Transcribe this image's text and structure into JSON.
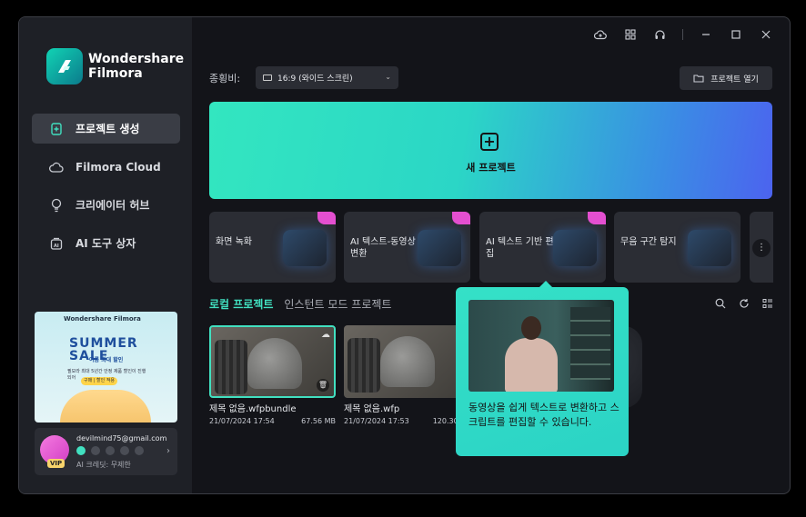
{
  "app": {
    "brand": "Wondershare",
    "product": "Filmora"
  },
  "sidebar": {
    "items": [
      {
        "label": "프로젝트 생성",
        "active": true
      },
      {
        "label": "Filmora Cloud",
        "active": false
      },
      {
        "label": "크리에이터 허브",
        "active": false
      },
      {
        "label": "AI 도구 상자",
        "active": false
      }
    ],
    "promo": {
      "brand": "Wondershare Filmora",
      "headline": "SUMMER SALE",
      "tagline": "여름 최대 할인",
      "detail": "필모라 최대 5년간 안정 제품 할인이 진행되어",
      "cta": "구매 | 할인 적용"
    },
    "account": {
      "email": "devilmind75@gmail.com",
      "vip": "VIP",
      "credit": "AI 크레딧: 무제한"
    }
  },
  "toolbar": {
    "ratio_label": "종횡비:",
    "ratio_value": "16:9 (와이드 스크린)",
    "open_project": "프로젝트 열기"
  },
  "new_project": {
    "label": "새 프로젝트"
  },
  "feature_cards": [
    {
      "label": "화면 녹화"
    },
    {
      "label": "AI 텍스트-동영상 변환"
    },
    {
      "label": "AI 텍스트 기반 편집"
    },
    {
      "label": "무음 구간 탐지"
    }
  ],
  "tabs": [
    {
      "label": "로컬 프로젝트",
      "active": true
    },
    {
      "label": "인스턴트 모드 프로젝트",
      "active": false
    }
  ],
  "projects": [
    {
      "name": "제목 없음.wfpbundle",
      "date": "21/07/2024 17:54",
      "size": "67.56 MB"
    },
    {
      "name": "제목 없음.wfp",
      "date": "21/07/2024 17:53",
      "size": "120.30 KB"
    }
  ],
  "tooltip": {
    "text": "동영상을 쉽게 텍스트로 변환하고 스크립트를 편집할 수 있습니다."
  },
  "colors": {
    "accent": "#41e0c0",
    "background": "#131419",
    "sidebar": "#1e2026"
  }
}
